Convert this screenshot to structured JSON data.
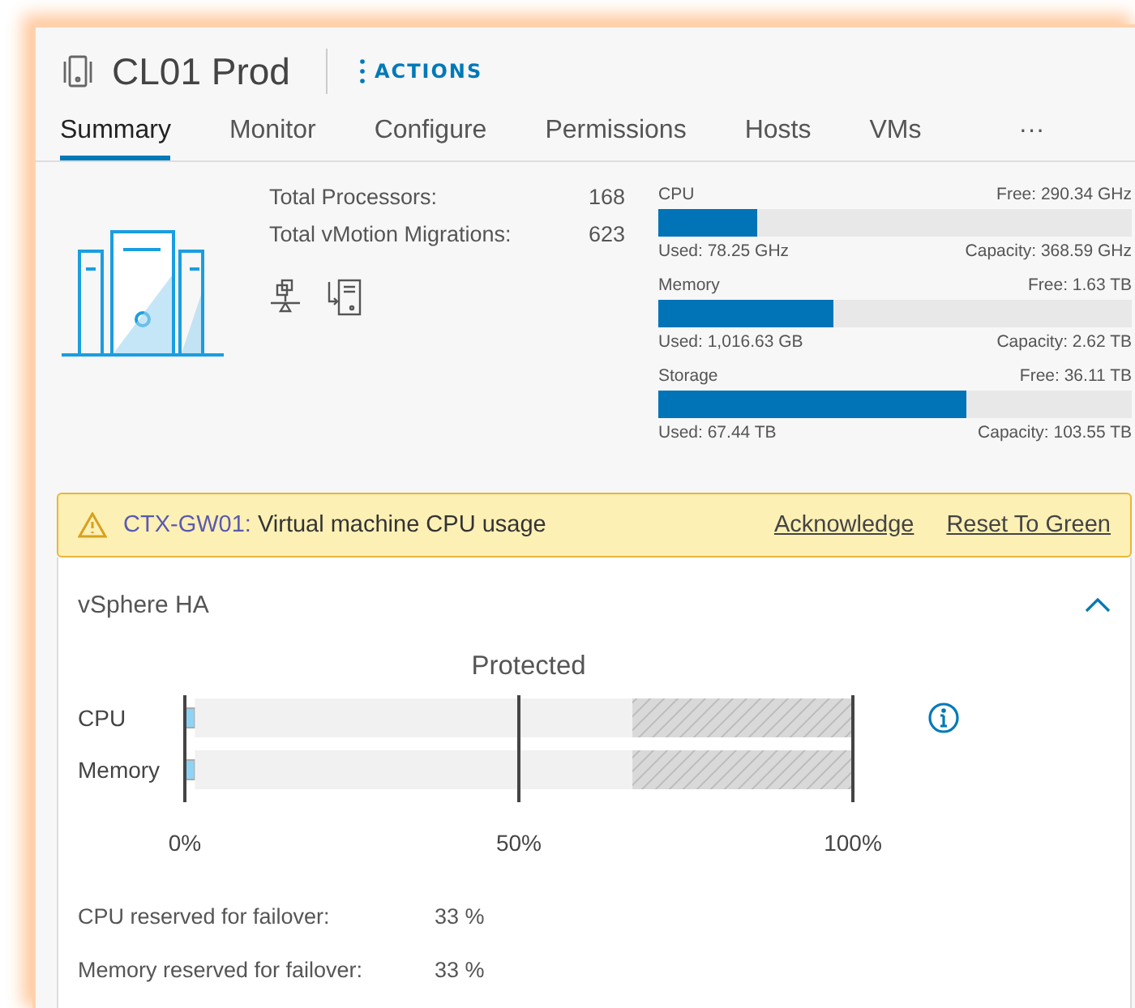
{
  "header": {
    "title": "CL01 Prod",
    "actions": "ACTIONS"
  },
  "tabs": [
    {
      "label": "Summary",
      "selected": true
    },
    {
      "label": "Monitor",
      "selected": false
    },
    {
      "label": "Configure",
      "selected": false
    },
    {
      "label": "Permissions",
      "selected": false
    },
    {
      "label": "Hosts",
      "selected": false
    },
    {
      "label": "VMs",
      "selected": false
    },
    {
      "label": "···",
      "selected": false
    }
  ],
  "stats": [
    {
      "label": "Total Processors:",
      "value": "168"
    },
    {
      "label": "Total vMotion Migrations:",
      "value": "623"
    }
  ],
  "resources": [
    {
      "name": "CPU",
      "free": "Free: 290.34 GHz",
      "used": "Used: 78.25 GHz",
      "capacity": "Capacity: 368.59 GHz",
      "level": 0.21
    },
    {
      "name": "Memory",
      "free": "Free: 1.63 TB",
      "used": "Used: 1,016.63 GB",
      "capacity": "Capacity: 2.62 TB",
      "level": 0.37
    },
    {
      "name": "Storage",
      "free": "Free: 36.11 TB",
      "used": "Used: 67.44 TB",
      "capacity": "Capacity: 103.55 TB",
      "level": 0.65
    }
  ],
  "alert": {
    "source": "CTX-GW01:",
    "message": "Virtual machine CPU usage",
    "actions": [
      "Acknowledge",
      "Reset To Green"
    ]
  },
  "ha_card": {
    "title": "vSphere HA",
    "expanded": true,
    "chart_data": {
      "type": "bar",
      "title": "Protected",
      "orientation": "horizontal",
      "stacked": true,
      "categories": [
        "CPU",
        "Memory"
      ],
      "series": [
        {
          "color": "#8fd3f4",
          "values": [
            1.5,
            1.5
          ]
        },
        {
          "color": "#f1f1f1",
          "values": [
            65.5,
            65.5
          ]
        },
        {
          "color": "#d9d9d9",
          "values": [
            33,
            33
          ]
        }
      ],
      "xlim": [
        0,
        100
      ],
      "xticks": [
        {
          "value": 0,
          "label": "0%"
        },
        {
          "value": 50,
          "label": "50%"
        },
        {
          "value": 100,
          "label": "100%"
        }
      ]
    },
    "details": [
      {
        "label": "CPU reserved for failover:",
        "value": "33 %"
      },
      {
        "label": "Memory reserved for failover:",
        "value": "33 %"
      }
    ]
  }
}
